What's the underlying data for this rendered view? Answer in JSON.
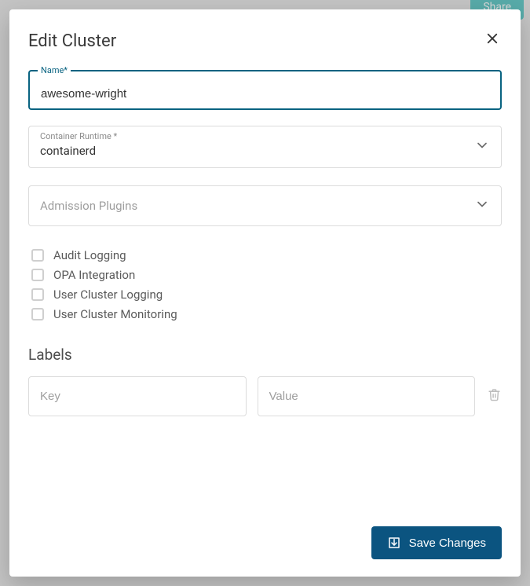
{
  "background": {
    "share_label": "Share"
  },
  "modal": {
    "title": "Edit Cluster",
    "name_field": {
      "label": "Name*",
      "value": "awesome-wright"
    },
    "runtime_field": {
      "label": "Container Runtime *",
      "value": "containerd"
    },
    "plugins_field": {
      "placeholder": "Admission Plugins"
    },
    "checkboxes": [
      {
        "label": "Audit Logging",
        "checked": false
      },
      {
        "label": "OPA Integration",
        "checked": false
      },
      {
        "label": "User Cluster Logging",
        "checked": false
      },
      {
        "label": "User Cluster Monitoring",
        "checked": false
      }
    ],
    "labels_section_heading": "Labels",
    "label_key_placeholder": "Key",
    "label_value_placeholder": "Value",
    "save_button": "Save Changes"
  }
}
